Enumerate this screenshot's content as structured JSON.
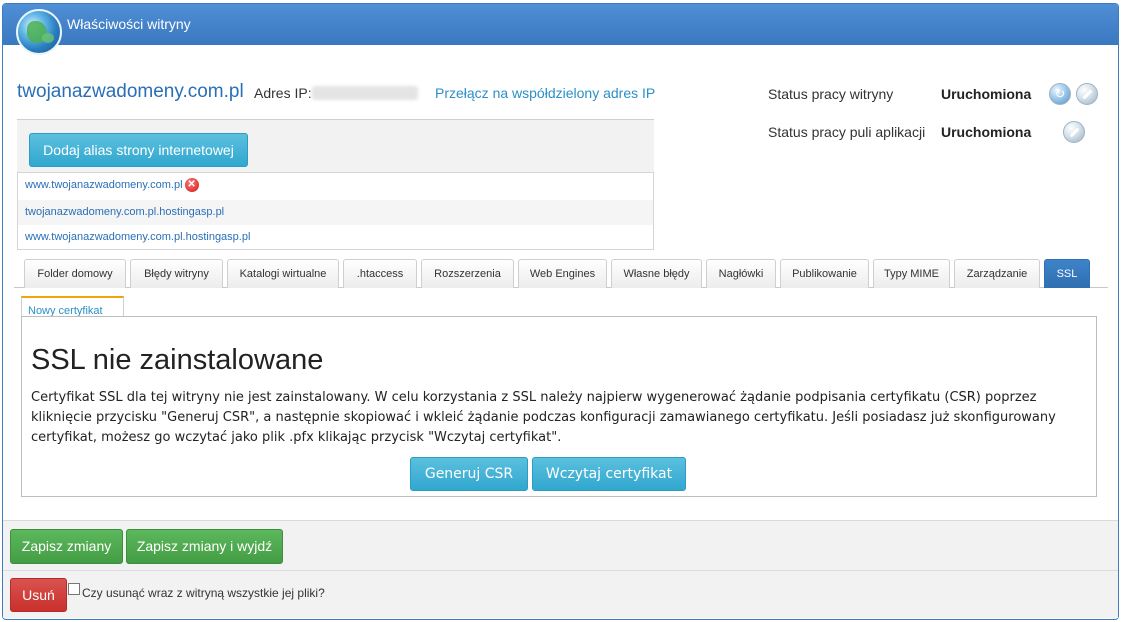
{
  "window": {
    "title": "Właściwości witryny"
  },
  "site": {
    "domain": "twojanazwadomeny.com.pl",
    "ip_label": "Adres IP:",
    "switch_ip_link": "Przełącz na współdzielony adres IP"
  },
  "status": {
    "site_label": "Status pracy witryny",
    "site_value": "Uruchomiona",
    "pool_label": "Status pracy puli aplikacji",
    "pool_value": "Uruchomiona"
  },
  "aliases": {
    "add_button": "Dodaj alias strony internetowej",
    "items": [
      "www.twojanazwadomeny.com.pl",
      "twojanazwadomeny.com.pl.hostingasp.pl",
      "www.twojanazwadomeny.com.pl.hostingasp.pl"
    ]
  },
  "tabs": [
    {
      "label": "Folder domowy"
    },
    {
      "label": "Błędy witryny"
    },
    {
      "label": "Katalogi wirtualne"
    },
    {
      "label": ".htaccess"
    },
    {
      "label": "Rozszerzenia"
    },
    {
      "label": "Web Engines"
    },
    {
      "label": "Własne błędy"
    },
    {
      "label": "Nagłówki"
    },
    {
      "label": "Publikowanie"
    },
    {
      "label": "Typy MIME"
    },
    {
      "label": "Zarządzanie"
    },
    {
      "label": "SSL"
    }
  ],
  "active_tab": "SSL",
  "ssl": {
    "subtab": "Nowy certyfikat",
    "title": "SSL nie zainstalowane",
    "description": "Certyfikat SSL dla tej witryny nie jest zainstalowany. W celu korzystania z SSL należy najpierw wygenerować żądanie podpisania certyfikatu (CSR) poprzez kliknięcie przycisku \"Generuj CSR\", a następnie skopiować i wkleić żądanie podczas konfiguracji zamawianego certyfikatu. Jeśli posiadasz już skonfigurowany certyfikat, możesz go wczytać jako plik .pfx klikając przycisk \"Wczytaj certyfikat\".",
    "generate_button": "Generuj CSR",
    "load_button": "Wczytaj certyfikat"
  },
  "footer": {
    "save": "Zapisz zmiany",
    "save_exit": "Zapisz zmiany i wyjdź",
    "delete": "Usuń",
    "delete_files_label": "Czy usunąć wraz z witryną wszystkie jej pliki?"
  },
  "colors": {
    "titlebar": "#3a78c0",
    "link": "#2a8fc8",
    "blue_button": "#31a7cf",
    "green_button": "#449d44",
    "red_button": "#c9302c"
  },
  "icons": [
    "globe-icon",
    "refresh-icon",
    "stop-icon",
    "delete-alias-icon"
  ]
}
